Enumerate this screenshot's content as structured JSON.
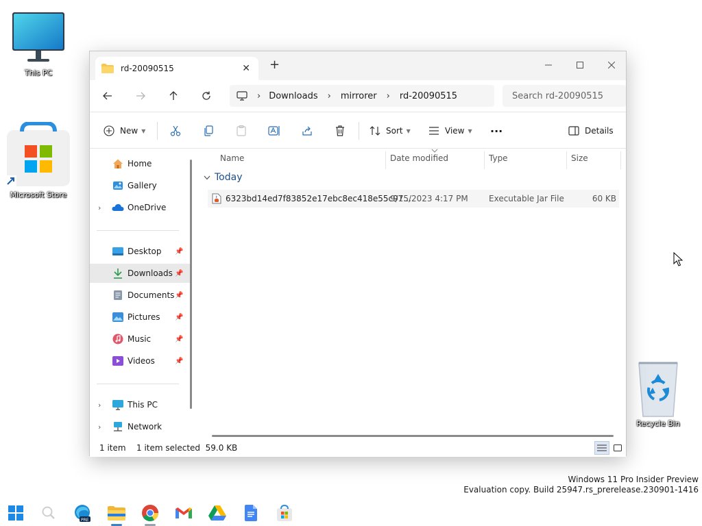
{
  "desktop": {
    "icons": [
      {
        "label": "This PC"
      },
      {
        "label": "Microsoft Store"
      },
      {
        "label": "Recycle Bin"
      }
    ]
  },
  "window": {
    "tab_title": "rd-20090515",
    "new_tab": "+",
    "breadcrumb": [
      "Downloads",
      "mirrorer",
      "rd-20090515"
    ],
    "search_placeholder": "Search rd-20090515",
    "toolbar": {
      "new_label": "New",
      "sort_label": "Sort",
      "view_label": "View",
      "more_label": "···",
      "details_label": "Details"
    },
    "sidebar": {
      "items": [
        {
          "label": "Home",
          "icon": "home-icon"
        },
        {
          "label": "Gallery",
          "icon": "gallery-icon"
        },
        {
          "label": "OneDrive",
          "icon": "onedrive-icon"
        },
        {
          "label": "Desktop",
          "icon": "desktop-folder-icon"
        },
        {
          "label": "Downloads",
          "icon": "downloads-icon"
        },
        {
          "label": "Documents",
          "icon": "documents-icon"
        },
        {
          "label": "Pictures",
          "icon": "pictures-icon"
        },
        {
          "label": "Music",
          "icon": "music-icon"
        },
        {
          "label": "Videos",
          "icon": "videos-icon"
        },
        {
          "label": "This PC",
          "icon": "this-pc-icon"
        },
        {
          "label": "Network",
          "icon": "network-icon"
        }
      ]
    },
    "columns": [
      "Name",
      "Date modified",
      "Type",
      "Size"
    ],
    "group_label": "Today",
    "files": [
      {
        "name": "6323bd14ed7f83852e17ebc8ec418e55c97...",
        "date": "9/15/2023 4:17 PM",
        "type": "Executable Jar File",
        "size": "60 KB"
      }
    ],
    "status": {
      "count": "1 item",
      "selected": "1 item selected  59.0 KB"
    }
  },
  "watermark": {
    "line1": "Windows 11 Pro Insider Preview",
    "line2": "Evaluation copy. Build 25947.rs_prerelease.230901-1416"
  },
  "colors": {
    "accent": "#0067c0",
    "folder": "#f8c74a"
  }
}
